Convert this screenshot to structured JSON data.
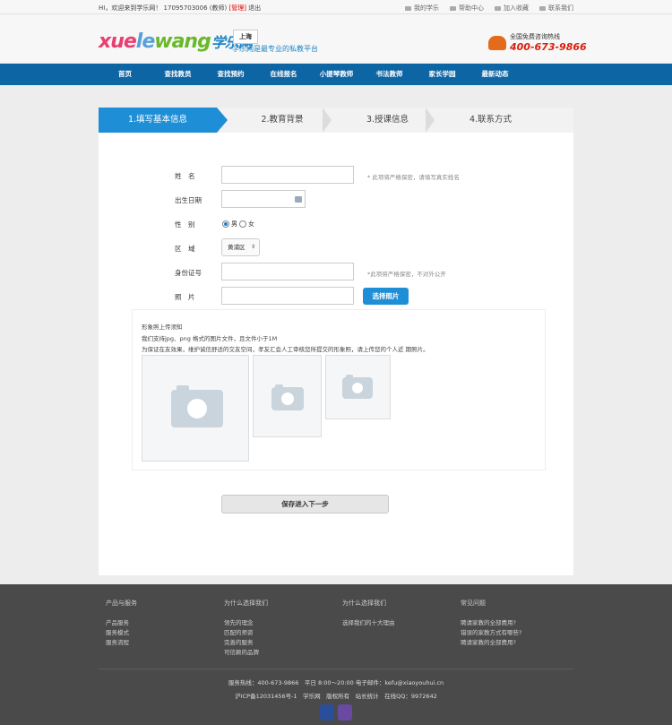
{
  "topbar": {
    "welcome": "HI，欢迎来到学乐网！ 17095703006 (教师)",
    "manage": "[管理]",
    "logout": "退出",
    "links": [
      "我的学乐",
      "帮助中心",
      "加入收藏",
      "联系我们"
    ]
  },
  "header": {
    "logo_latin_1": "xue",
    "logo_latin_2": "le",
    "logo_latin_3": "wang",
    "logo_cn": "学乐网",
    "city": "上海",
    "slogan": "学乐网是最专业的私教平台",
    "hotline_label": "全国免费咨询热线",
    "hotline_number": "400-673-9866"
  },
  "nav": {
    "items": [
      "首页",
      "查找教员",
      "查找预约",
      "在线报名",
      "小提琴教师",
      "书法教师",
      "家长学园",
      "最新动态"
    ]
  },
  "steps": [
    {
      "label": "1.填写基本信息"
    },
    {
      "label": "2.教育背景"
    },
    {
      "label": "3.授课信息"
    },
    {
      "label": "4.联系方式"
    }
  ],
  "form": {
    "name_label": "姓　名",
    "name_hint": "* 此项将严格保密，请填写真实姓名",
    "birth_label": "出生日期",
    "gender_label": "性　别",
    "gender_male": "男",
    "gender_female": "女",
    "gender_selected": "男",
    "region_label": "区　域",
    "region_value": "黄浦区",
    "id_label": "身份证号",
    "id_hint": "*此项将严格保密，不对外公开",
    "photo_label": "照　片",
    "photo_button": "选择照片"
  },
  "upload": {
    "title": "形象照上传须知",
    "line1": "我们支持jpg、png 格式的图片文件，且文件小于1M",
    "line2": "为保证在友效果，维护诚信舒适的交友空间，孝友汇会人工审核您所提交的形象照，请上传您的个人近 期照片。"
  },
  "next_button": "保存进入下一步",
  "footer": {
    "columns": [
      {
        "heading": "产品与服务",
        "items": [
          "产品服务",
          "服务模式",
          "服务流程"
        ]
      },
      {
        "heading": "为什么选择我们",
        "items": [
          "领先的理念",
          "匹配的师资",
          "完善的服务",
          "可信赖的品牌"
        ]
      },
      {
        "heading": "为什么选择我们",
        "items": [
          "选择我们的十大理由"
        ]
      },
      {
        "heading": "常见问题",
        "items": [
          "聘请家教的全部费用?",
          "错误的家教方式有哪些?",
          "聘请家教的全部费用?"
        ]
      }
    ],
    "service_line": "服务热线：400-673-9866　平日 8:00～20:00 电子邮件：kefu@xiaoyouhui.cn",
    "icp_line": "沪ICP备12031456号-1　学乐网　版权所有　站长统计　在线QQ：9972642"
  }
}
